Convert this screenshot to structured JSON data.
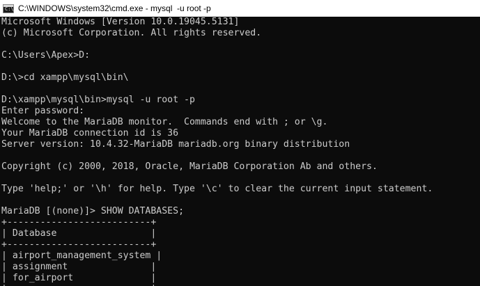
{
  "window": {
    "title": "C:\\WINDOWS\\system32\\cmd.exe - mysql  -u root -p",
    "icon": "cmd-icon",
    "icon_glyph": "C:\\"
  },
  "console": {
    "lines": [
      "Microsoft Windows [Version 10.0.19045.5131]",
      "(c) Microsoft Corporation. All rights reserved.",
      "",
      "C:\\Users\\Apex>D:",
      "",
      "D:\\>cd xampp\\mysql\\bin\\",
      "",
      "D:\\xampp\\mysql\\bin>mysql -u root -p",
      "Enter password:",
      "Welcome to the MariaDB monitor.  Commands end with ; or \\g.",
      "Your MariaDB connection id is 36",
      "Server version: 10.4.32-MariaDB mariadb.org binary distribution",
      "",
      "Copyright (c) 2000, 2018, Oracle, MariaDB Corporation Ab and others.",
      "",
      "Type 'help;' or '\\h' for help. Type '\\c' to clear the current input statement.",
      "",
      "MariaDB [(none)]> SHOW DATABASES;",
      "+--------------------------+",
      "| Database                 |",
      "+--------------------------+",
      "| airport_management_system |",
      "| assignment               |",
      "| for_airport              |",
      "| ...                      |"
    ]
  },
  "colors": {
    "background": "#0c0c0c",
    "text": "#cccccc",
    "titlebar": "#ffffff"
  }
}
